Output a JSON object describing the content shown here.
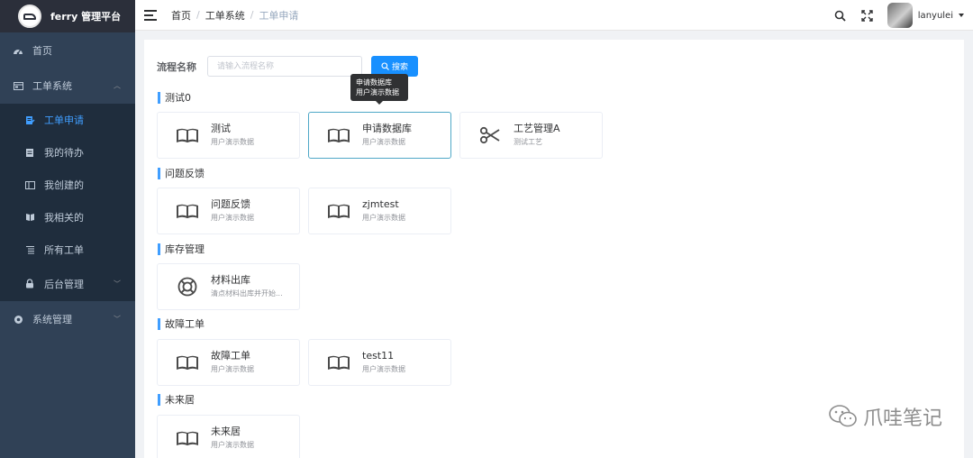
{
  "app": {
    "title": "ferry 管理平台"
  },
  "sidebar": {
    "items": [
      {
        "label": "首页",
        "icon": "dashboard-icon"
      },
      {
        "label": "工单系统",
        "icon": "ticket-system-icon",
        "expanded": true,
        "children": [
          {
            "label": "工单申请",
            "icon": "apply-icon",
            "active": true
          },
          {
            "label": "我的待办",
            "icon": "todo-icon"
          },
          {
            "label": "我创建的",
            "icon": "created-icon"
          },
          {
            "label": "我相关的",
            "icon": "related-icon"
          },
          {
            "label": "所有工单",
            "icon": "all-tickets-icon"
          },
          {
            "label": "后台管理",
            "icon": "lock-icon"
          }
        ]
      },
      {
        "label": "系统管理",
        "icon": "settings-icon"
      }
    ]
  },
  "header": {
    "breadcrumb": [
      "首页",
      "工单系统",
      "工单申请"
    ],
    "username": "lanyulei"
  },
  "search": {
    "label": "流程名称",
    "placeholder": "请输入流程名称",
    "button_label": "搜索"
  },
  "tooltip": {
    "line1": "申请数据库",
    "line2": "用户演示数据"
  },
  "sections": [
    {
      "title": "测试0",
      "cards": [
        {
          "name": "测试",
          "desc": "用户演示数据",
          "icon": "book-icon"
        },
        {
          "name": "申请数据库",
          "desc": "用户演示数据",
          "icon": "book-icon"
        },
        {
          "name": "工艺管理A",
          "desc": "测试工艺",
          "icon": "scissors-icon"
        }
      ]
    },
    {
      "title": "问题反馈",
      "cards": [
        {
          "name": "问题反馈",
          "desc": "用户演示数据",
          "icon": "book-icon"
        },
        {
          "name": "zjmtest",
          "desc": "用户演示数据",
          "icon": "book-icon"
        }
      ]
    },
    {
      "title": "库存管理",
      "cards": [
        {
          "name": "材料出库",
          "desc": "清点材料出库并开始...",
          "icon": "lifebuoy-icon"
        }
      ]
    },
    {
      "title": "故障工单",
      "cards": [
        {
          "name": "故障工单",
          "desc": "用户演示数据",
          "icon": "book-icon"
        },
        {
          "name": "test11",
          "desc": "用户演示数据",
          "icon": "book-icon"
        }
      ]
    },
    {
      "title": "未来居",
      "cards": [
        {
          "name": "未来居",
          "desc": "用户演示数据",
          "icon": "book-icon"
        }
      ]
    }
  ],
  "watermark": {
    "text": "爪哇笔记"
  },
  "colors": {
    "sidebar": "#304156",
    "accent": "#409eff",
    "button": "#1890ff"
  }
}
